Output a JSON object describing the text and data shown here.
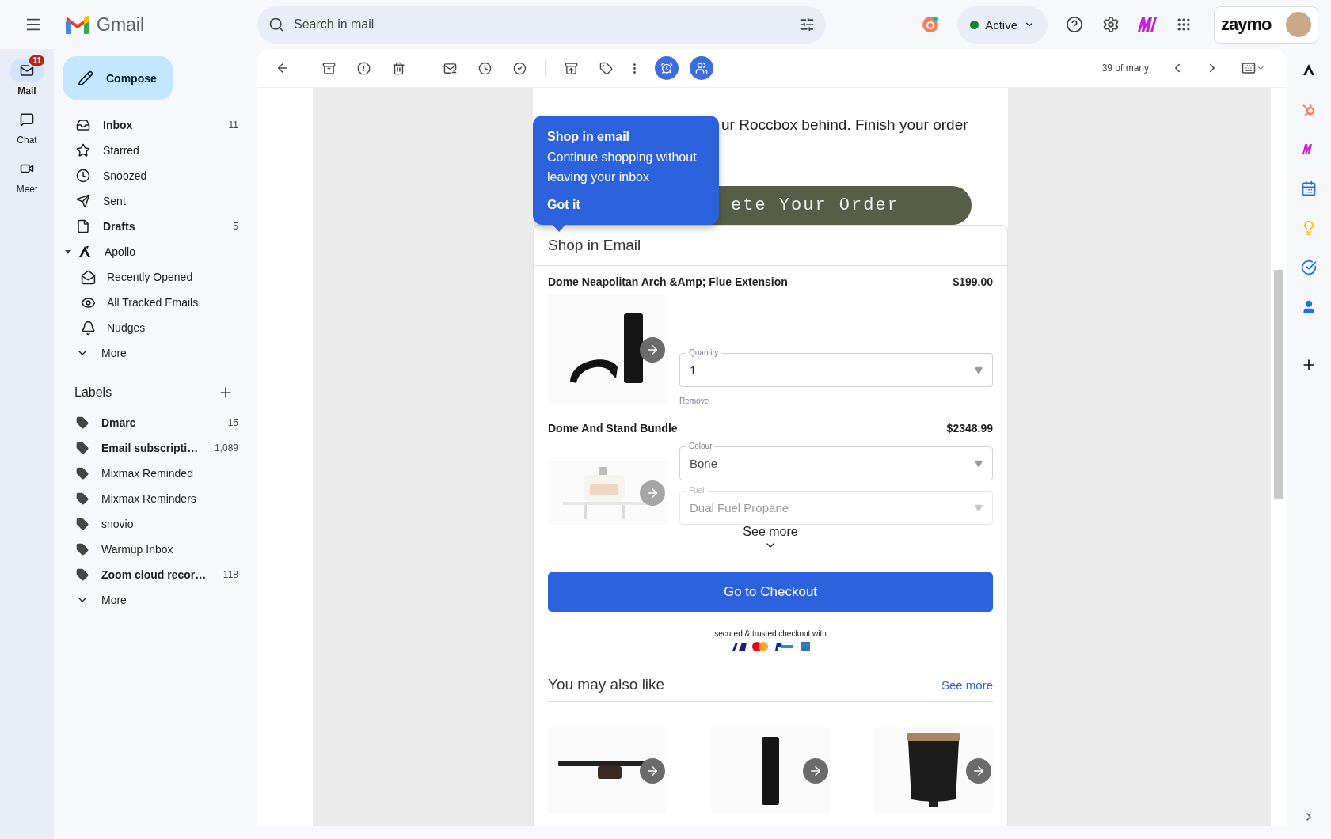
{
  "topbar": {
    "product_name": "Gmail",
    "search": {
      "placeholder": "Search in mail"
    },
    "status": "Active",
    "account_brand": "zaymo"
  },
  "rail": [
    {
      "kind": "mail",
      "label": "Mail",
      "badge": "11",
      "selected": true
    },
    {
      "kind": "chat",
      "label": "Chat",
      "selected": false
    },
    {
      "kind": "meet",
      "label": "Meet",
      "selected": false
    }
  ],
  "compose": "Compose",
  "nav": [
    {
      "kind": "inbox",
      "label": "Inbox",
      "count": "11",
      "unread": true
    },
    {
      "kind": "starred",
      "label": "Starred",
      "unread": false
    },
    {
      "kind": "snoozed",
      "label": "Snoozed",
      "unread": false
    },
    {
      "kind": "sent",
      "label": "Sent",
      "unread": false
    },
    {
      "kind": "drafts",
      "label": "Drafts",
      "count": "5",
      "unread": true
    }
  ],
  "apollo": {
    "label": "Apollo",
    "expanded": true,
    "children": [
      {
        "kind": "opened",
        "label": "Recently Opened"
      },
      {
        "kind": "tracked",
        "label": "All Tracked Emails"
      },
      {
        "kind": "nudges",
        "label": "Nudges"
      }
    ]
  },
  "nav_more": "More",
  "labels": {
    "title": "Labels",
    "items": [
      {
        "label": "Dmarc",
        "count": "15",
        "unread": true
      },
      {
        "label": "Email subscripti…",
        "count": "1,089",
        "unread": true
      },
      {
        "label": "Mixmax Reminded",
        "unread": false
      },
      {
        "label": "Mixmax Reminders",
        "unread": false
      },
      {
        "label": "snovio",
        "unread": false
      },
      {
        "label": "Warmup Inbox",
        "unread": false
      },
      {
        "label": "Zoom cloud recor…",
        "count": "118",
        "unread": true
      }
    ],
    "more": "More"
  },
  "toolbar": {
    "pager": "39 of many"
  },
  "email": {
    "intro": "ur Roccbox behind. Finish your order",
    "cta": "ete Your Order",
    "tooltip": {
      "title": "Shop in email",
      "body": "Continue shopping without leaving your inbox",
      "action": "Got it"
    },
    "shop": {
      "title": "Shop in Email",
      "products": [
        {
          "kind": "arch-flue",
          "name": "Dome Neapolitan Arch &Amp; Flue Extension",
          "price": "$199.00",
          "fields": [
            {
              "label": "Quantity",
              "value": "1",
              "faded": false
            }
          ],
          "remove": "Remove"
        },
        {
          "kind": "oven",
          "name": "Dome And Stand Bundle",
          "price": "$2348.99",
          "fields": [
            {
              "label": "Colour",
              "value": "Bone",
              "faded": false
            },
            {
              "label": "Fuel",
              "value": "Dual Fuel Propane",
              "faded": true
            }
          ]
        }
      ],
      "see_more": "See more",
      "checkout": "Go to Checkout",
      "secure_note": "secured & trusted checkout with"
    },
    "recommendations": {
      "title": "You may also like",
      "link": "See more",
      "items": [
        {
          "kind": "tray"
        },
        {
          "kind": "flue"
        },
        {
          "kind": "jar"
        }
      ]
    }
  }
}
